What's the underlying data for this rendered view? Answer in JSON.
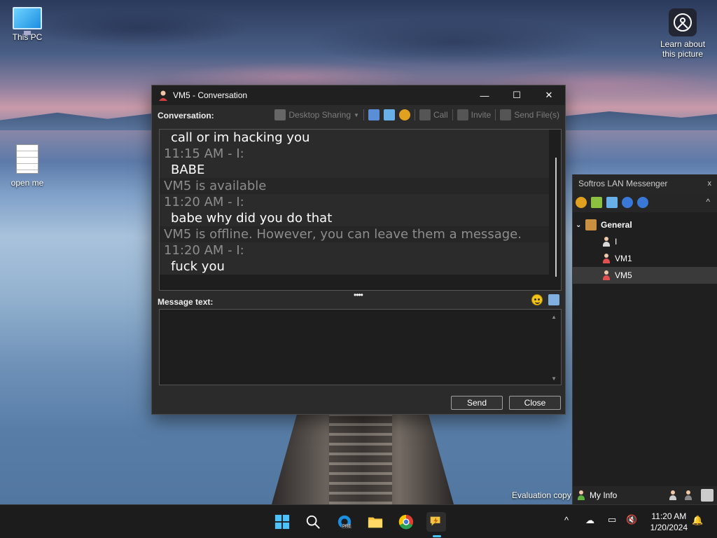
{
  "desktop": {
    "icons": [
      {
        "label": "This PC"
      },
      {
        "label": "open me"
      }
    ],
    "learn": {
      "line1": "Learn about",
      "line2": "this picture"
    },
    "evaluation": "Evaluation copy"
  },
  "conversation_window": {
    "title": "VM5 - Conversation",
    "controls": {
      "minimize": "—",
      "maximize": "☐",
      "close": "✕"
    },
    "toolbar": {
      "conversation_label": "Conversation:",
      "desktop_sharing": "Desktop Sharing",
      "call": "Call",
      "invite": "Invite",
      "send_files": "Send File(s)"
    },
    "lines": [
      {
        "kind": "msg",
        "text": "call or im hacking you"
      },
      {
        "kind": "hdr",
        "text": "11:15 AM - I:"
      },
      {
        "kind": "msg",
        "text": "BABE"
      },
      {
        "kind": "sys",
        "text": "VM5 is available"
      },
      {
        "kind": "hdr",
        "text": "11:20 AM - I:"
      },
      {
        "kind": "msg",
        "text": "babe why did you do that"
      },
      {
        "kind": "sys",
        "text": "VM5 is offline. However, you can leave them a message."
      },
      {
        "kind": "hdr",
        "text": "11:20 AM - I:"
      },
      {
        "kind": "msg",
        "text": "fuck you"
      }
    ],
    "splitter": "••••",
    "message_label": "Message text:",
    "message_value": "",
    "send_label": "Send",
    "close_label": "Close"
  },
  "messenger": {
    "title": "Softros LAN Messenger",
    "close": "x",
    "group": "General",
    "users": [
      {
        "name": "I",
        "color": "#d8d8d8",
        "selected": false
      },
      {
        "name": "VM1",
        "color": "#e05050",
        "selected": false
      },
      {
        "name": "VM5",
        "color": "#e05050",
        "selected": true
      }
    ],
    "my_info": "My Info"
  },
  "taskbar": {
    "time": "11:20 AM",
    "date": "1/20/2024",
    "edge_badge": "PRE"
  }
}
